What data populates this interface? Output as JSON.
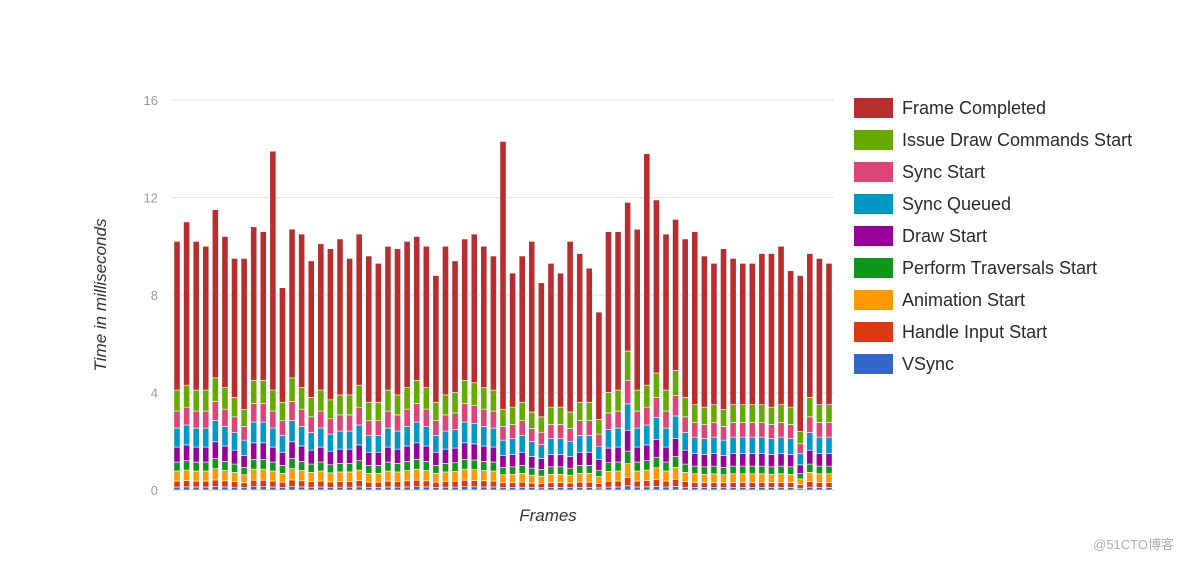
{
  "chart_data": {
    "type": "bar",
    "stacked": true,
    "title": "",
    "xlabel": "Frames",
    "ylabel": "Time in milliseconds",
    "ylim": [
      0,
      16
    ],
    "yticks": [
      0,
      4,
      8,
      12,
      16
    ],
    "grid": true,
    "legend_position": "right",
    "frame_count": 69,
    "series": [
      {
        "name": "VSync",
        "color": "#3366cc"
      },
      {
        "name": "Handle Input Start",
        "color": "#dc3912"
      },
      {
        "name": "Animation Start",
        "color": "#ff9900"
      },
      {
        "name": "Perform Traversals Start",
        "color": "#109618"
      },
      {
        "name": "Draw Start",
        "color": "#990099"
      },
      {
        "name": "Sync Queued",
        "color": "#0099c6"
      },
      {
        "name": "Sync Start",
        "color": "#dd4477"
      },
      {
        "name": "Issue Draw Commands Start",
        "color": "#66aa00"
      },
      {
        "name": "Frame Completed",
        "color": "#b82e2e"
      }
    ],
    "legend_order": [
      "Frame Completed",
      "Issue Draw Commands Start",
      "Sync Start",
      "Sync Queued",
      "Draw Start",
      "Perform Traversals Start",
      "Animation Start",
      "Handle Input Start",
      "VSync"
    ],
    "totals": [
      10.2,
      11.0,
      10.2,
      10.0,
      11.5,
      10.4,
      9.5,
      9.5,
      10.8,
      10.6,
      13.9,
      8.3,
      10.7,
      10.5,
      9.4,
      10.1,
      9.9,
      10.3,
      9.5,
      10.5,
      9.6,
      9.3,
      10.0,
      9.9,
      10.2,
      10.4,
      10.0,
      8.8,
      10.0,
      9.4,
      10.3,
      10.5,
      10.0,
      9.6,
      14.3,
      8.9,
      9.6,
      10.2,
      8.5,
      9.3,
      8.9,
      10.2,
      9.7,
      9.1,
      7.3,
      10.6,
      10.6,
      11.8,
      10.7,
      13.8,
      11.9,
      10.5,
      11.1,
      10.3,
      10.6,
      9.6,
      9.3,
      9.9,
      9.5,
      9.3,
      9.3,
      9.7,
      9.7,
      10.0,
      9.0,
      8.8,
      9.7,
      9.5,
      9.3
    ],
    "issue_draw_end": [
      4.1,
      4.3,
      4.1,
      4.1,
      4.6,
      4.2,
      3.8,
      3.3,
      4.5,
      4.5,
      4.1,
      3.6,
      4.6,
      4.2,
      3.8,
      4.1,
      3.7,
      3.9,
      3.9,
      4.3,
      3.6,
      3.6,
      4.1,
      3.9,
      4.2,
      4.5,
      4.2,
      3.6,
      3.9,
      4.0,
      4.5,
      4.4,
      4.2,
      4.1,
      3.3,
      3.4,
      3.6,
      3.2,
      3.0,
      3.4,
      3.4,
      3.2,
      3.6,
      3.6,
      2.9,
      4.0,
      4.1,
      5.7,
      4.1,
      4.3,
      4.8,
      4.1,
      4.9,
      3.8,
      3.5,
      3.4,
      3.5,
      3.3,
      3.5,
      3.5,
      3.5,
      3.5,
      3.4,
      3.5,
      3.4,
      2.4,
      3.8,
      3.5,
      3.5
    ],
    "segment_fractions_of_base": {
      "VSync": 0.03,
      "Handle Input Start": 0.06,
      "Animation Start": 0.1,
      "Perform Traversals Start": 0.09,
      "Draw Start": 0.15,
      "Sync Queued": 0.19,
      "Sync Start": 0.17,
      "Issue Draw Commands Start": 0.21
    }
  },
  "watermark": "@51CTO博客"
}
